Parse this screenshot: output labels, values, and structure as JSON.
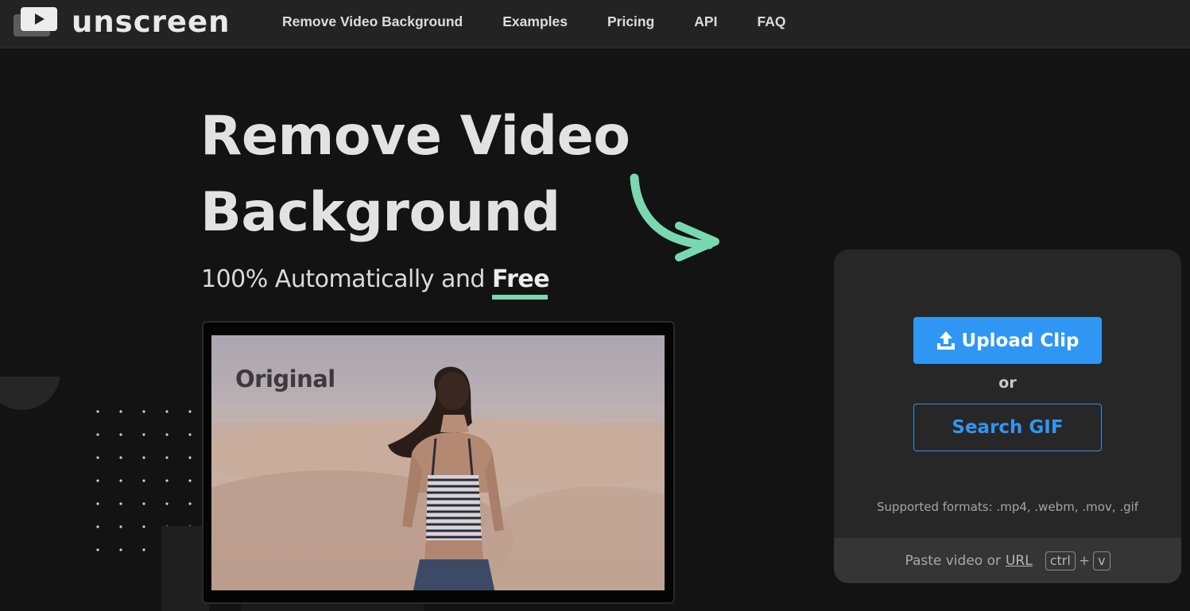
{
  "brand": {
    "name": "unscreen"
  },
  "nav": {
    "links": [
      "Remove Video Background",
      "Examples",
      "Pricing",
      "API",
      "FAQ"
    ]
  },
  "hero": {
    "title_line1": "Remove Video",
    "title_line2": "Background",
    "subtitle_prefix": "100% Automatically and",
    "subtitle_emphasis": "Free",
    "accent_color": "#7ad8b1"
  },
  "preview": {
    "label": "Original"
  },
  "upload": {
    "upload_label": "Upload Clip",
    "or_label": "or",
    "search_label": "Search GIF",
    "formats": "Supported formats: .mp4, .webm, .mov, .gif",
    "paste_prefix": "Paste video or",
    "paste_link": "URL",
    "key_ctrl": "ctrl",
    "key_plus": "+",
    "key_v": "v",
    "primary_color": "#2f97f3"
  }
}
